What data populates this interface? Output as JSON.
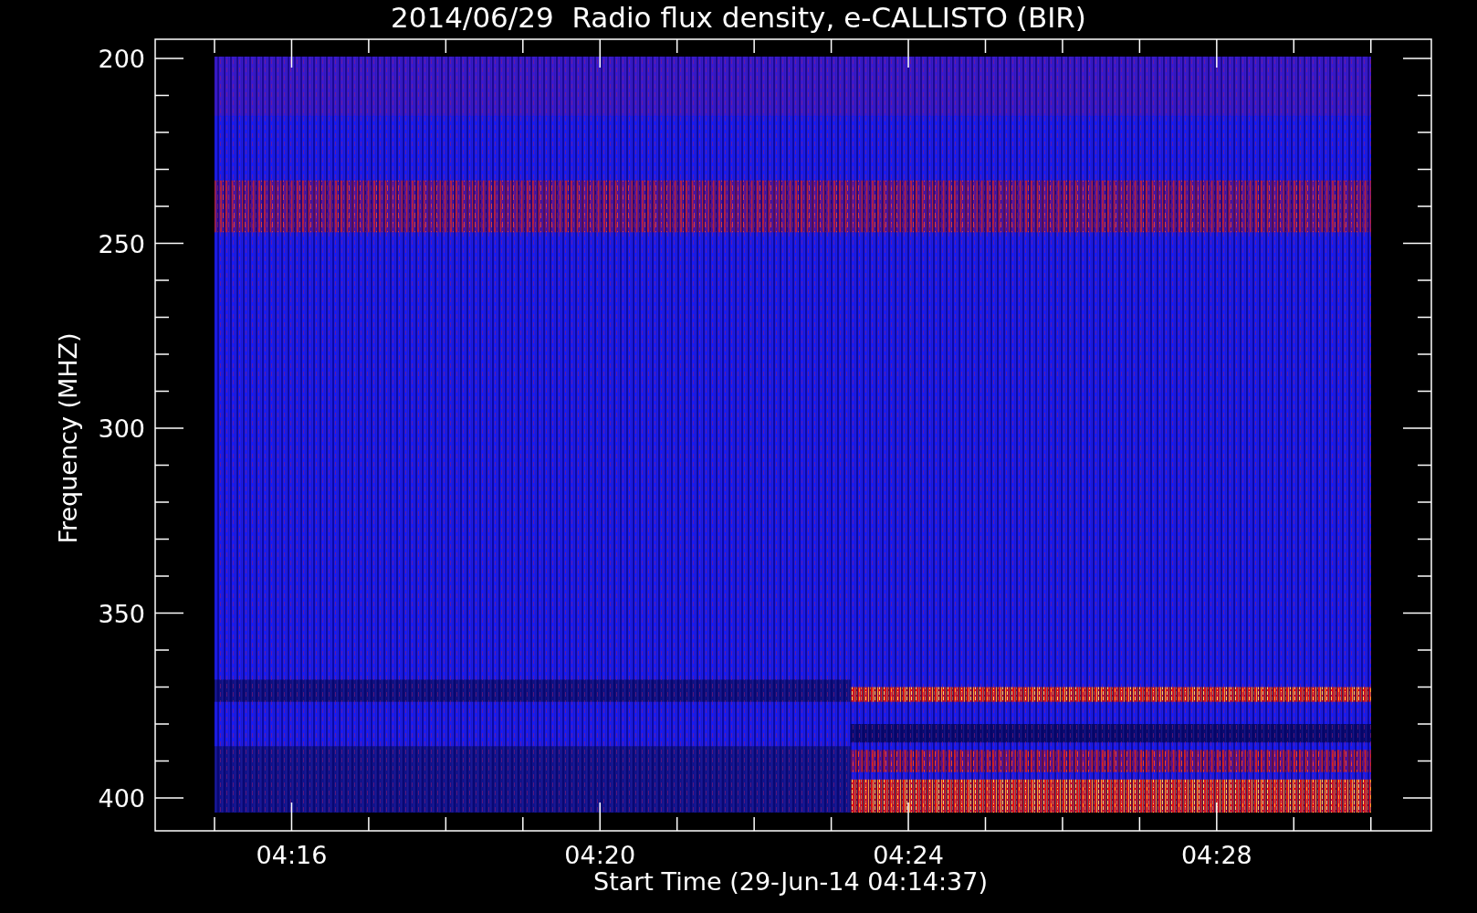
{
  "title": "2014/06/29  Radio flux density, e-CALLISTO (BIR)",
  "y_axis": {
    "label": "Frequency (MHZ)",
    "ticks": [
      "200",
      "250",
      "300",
      "350",
      "400"
    ]
  },
  "x_axis": {
    "label": "Start Time (29-Jun-14 04:14:37)",
    "ticks": [
      "04:16",
      "04:20",
      "04:24",
      "04:28"
    ]
  }
}
